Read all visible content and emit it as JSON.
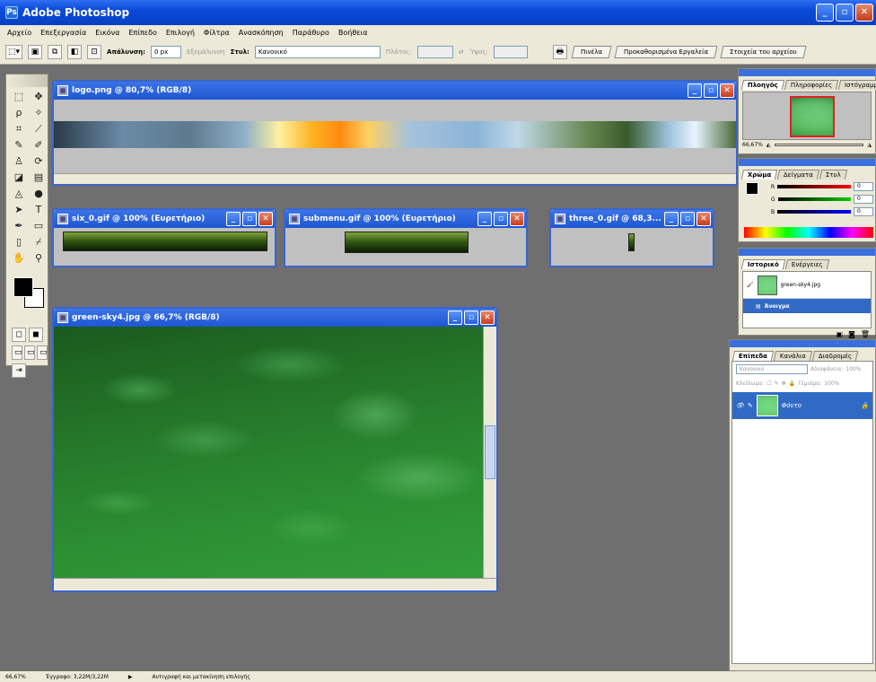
{
  "app": {
    "title": "Adobe Photoshop"
  },
  "menu": [
    "Αρχείο",
    "Επεξεργασία",
    "Εικόνα",
    "Επίπεδο",
    "Επιλογή",
    "Φίλτρα",
    "Ανασκόπηση",
    "Παράθυρο",
    "Βοήθεια"
  ],
  "options": {
    "feather_label": "Απάλυνση:",
    "feather_value": "0 px",
    "antialias_label": "Εξομάλυνση",
    "style_label": "Στυλ:",
    "style_value": "Κανονικό",
    "width_label": "Πλάτος:",
    "height_label": "Ύψος:",
    "tabs": [
      "Πινέλα",
      "Προκαθορισμένα Εργαλεία",
      "Στοιχεία του αρχείου"
    ]
  },
  "documents": {
    "logo": {
      "title": "logo.png @ 80,7% (RGB/8)"
    },
    "six": {
      "title": "six_0.gif @ 100% (Ευρετήριο)"
    },
    "submenu": {
      "title": "submenu.gif @ 100% (Ευρετήριο)"
    },
    "three": {
      "title": "three_0.gif @ 68,3..."
    },
    "sky": {
      "title": "green-sky4.jpg @ 66,7% (RGB/8)"
    }
  },
  "navigator": {
    "tabs": [
      "Πλοηγός",
      "Πληροφορίες",
      "Ιστόγραμμα"
    ],
    "zoom": "66,67%"
  },
  "color_panel": {
    "tabs": [
      "Χρώμα",
      "Δείγματα",
      "Στυλ"
    ],
    "channels": [
      "R",
      "G",
      "B"
    ],
    "values": [
      "0",
      "0",
      "0"
    ]
  },
  "history": {
    "tabs": [
      "Ιστορικό",
      "Ενέργειες"
    ],
    "items": [
      "green-sky4.jpg",
      "Άνοιγμα"
    ]
  },
  "layers": {
    "tabs": [
      "Επίπεδα",
      "Κανάλια",
      "Διαδρομές"
    ],
    "blend_mode": "Κανονικό",
    "opacity_label": "Αδιαφάνεια:",
    "opacity_value": "100%",
    "lock_label": "Κλείδωμα:",
    "fill_label": "Γέμισμα:",
    "fill_value": "100%",
    "layer_name": "Φόντο"
  },
  "status": {
    "zoom": "66,67%",
    "doc": "Έγγραφο: 3,22M/3,22M",
    "hint": "Αντιγραφή και μετακίνηση επιλογής"
  },
  "colors": {
    "titlebar": "#0a4ad8",
    "chrome": "#ece9d8",
    "workspace": "#6f6f6f",
    "doc_bg": "#c0c0c0"
  }
}
